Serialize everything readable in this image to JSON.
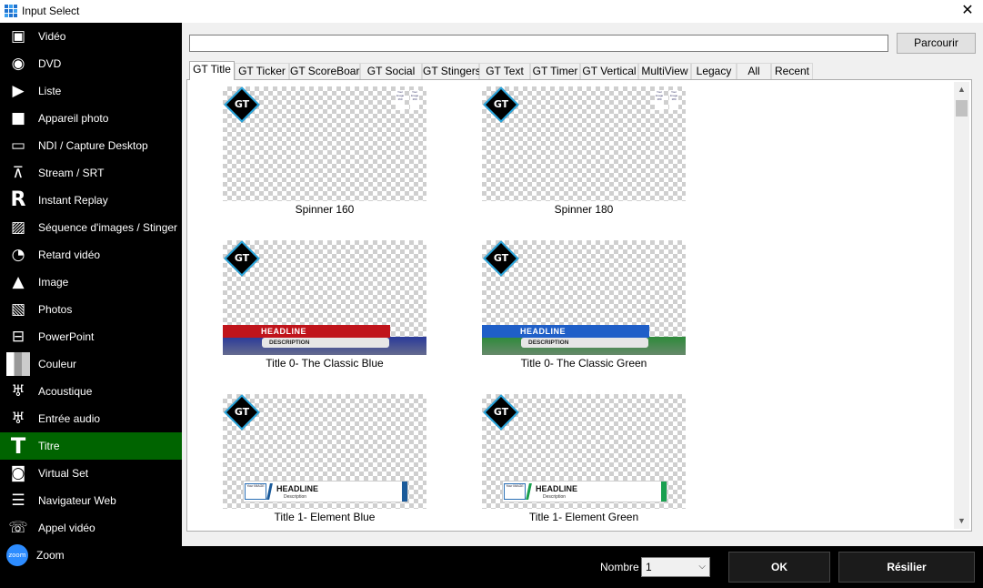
{
  "window": {
    "title": "Input Select",
    "close_glyph": "✕"
  },
  "sidebar": {
    "items": [
      {
        "label": "Vidéo",
        "icon": "film-icon",
        "glyph": "▣"
      },
      {
        "label": "DVD",
        "icon": "disc-icon",
        "glyph": "◉"
      },
      {
        "label": "Liste",
        "icon": "playlist-icon",
        "glyph": "▶"
      },
      {
        "label": "Appareil photo",
        "icon": "camera-icon",
        "glyph": "■"
      },
      {
        "label": "NDI / Capture Desktop",
        "icon": "monitor-icon",
        "glyph": "▭"
      },
      {
        "label": "Stream / SRT",
        "icon": "antenna-icon",
        "glyph": "⊼"
      },
      {
        "label": "Instant Replay",
        "icon": "replay-icon",
        "glyph": "R"
      },
      {
        "label": "Séquence d'images / Stinger",
        "icon": "image-sequence-icon",
        "glyph": "▨"
      },
      {
        "label": "Retard vidéo",
        "icon": "clock-icon",
        "glyph": "◔"
      },
      {
        "label": "Image",
        "icon": "image-icon",
        "glyph": "▲"
      },
      {
        "label": "Photos",
        "icon": "photos-icon",
        "glyph": "▧"
      },
      {
        "label": "PowerPoint",
        "icon": "presentation-icon",
        "glyph": "⊟"
      },
      {
        "label": "Couleur",
        "icon": "color-icon",
        "glyph": "▥"
      },
      {
        "label": "Acoustique",
        "icon": "microphone-icon",
        "glyph": "♅"
      },
      {
        "label": "Entrée audio",
        "icon": "audio-input-icon",
        "glyph": "♅"
      },
      {
        "label": "Titre",
        "icon": "title-icon",
        "glyph": "T"
      },
      {
        "label": "Virtual Set",
        "icon": "virtual-set-icon",
        "glyph": "◙"
      },
      {
        "label": "Navigateur Web",
        "icon": "browser-icon",
        "glyph": "☰"
      },
      {
        "label": "Appel vidéo",
        "icon": "video-call-icon",
        "glyph": "☏"
      },
      {
        "label": "Zoom",
        "icon": "zoom-icon",
        "glyph": "zoom"
      }
    ],
    "active_index": 15,
    "colors": {
      "background": "#000000",
      "active": "#006400"
    }
  },
  "search": {
    "value": "",
    "browse_label": "Parcourir"
  },
  "tabs": [
    {
      "label": "GT Title"
    },
    {
      "label": "GT Ticker"
    },
    {
      "label": "GT ScoreBoard"
    },
    {
      "label": "GT Social"
    },
    {
      "label": "GT Stingers"
    },
    {
      "label": "GT Text"
    },
    {
      "label": "GT Timer"
    },
    {
      "label": "GT Vertical"
    },
    {
      "label": "MultiView"
    },
    {
      "label": "Legacy"
    },
    {
      "label": "All"
    },
    {
      "label": "Recent"
    }
  ],
  "active_tab": 0,
  "gt_logo_text": "GT",
  "templates": [
    {
      "name": "Spinner 160",
      "kind": "spinner",
      "card_text": "Your Image 160"
    },
    {
      "name": "Spinner 180",
      "kind": "spinner",
      "card_text": "Your Image 180"
    },
    {
      "name": "Title 0- The Classic Blue",
      "kind": "classic",
      "headline": "HEADLINE",
      "description": "DESCRIPTION",
      "accent": "#c0141b",
      "base": "#2a3a9a"
    },
    {
      "name": "Title 0- The Classic Green",
      "kind": "classic",
      "headline": "HEADLINE",
      "description": "DESCRIPTION",
      "accent": "#1f5fc8",
      "base": "#2e8b3a"
    },
    {
      "name": "Title 1- Element Blue",
      "kind": "element",
      "headline": "HEADLINE",
      "description": "Description",
      "image_text": "Your IMAGE",
      "accent": "#1a5a9a"
    },
    {
      "name": "Title 1- Element Green",
      "kind": "element",
      "headline": "HEADLINE",
      "description": "Description",
      "image_text": "Your IMAGE",
      "accent": "#1aa050"
    }
  ],
  "footer": {
    "count_label": "Nombre",
    "count_value": "1",
    "ok_label": "OK",
    "cancel_label": "Résilier"
  },
  "scroll": {
    "up_glyph": "▲",
    "down_glyph": "▼"
  }
}
